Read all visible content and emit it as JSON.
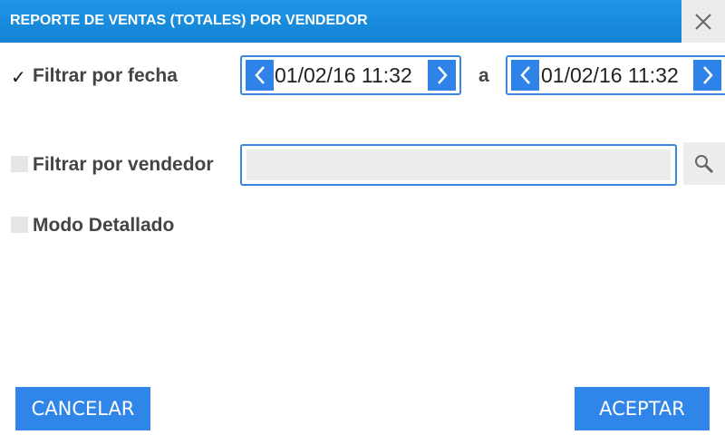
{
  "dialog": {
    "title": "REPORTE DE VENTAS (TOTALES) POR VENDEDOR",
    "close_icon": "close-icon"
  },
  "filters": {
    "date": {
      "check": "✓",
      "label": "Filtrar por fecha",
      "from_value": "01/02/16 11:32",
      "separator": "a",
      "to_value": "01/02/16 11:32"
    },
    "vendor": {
      "label": "Filtrar por vendedor",
      "value": "",
      "search_icon": "search-icon"
    },
    "detailed": {
      "label": "Modo Detallado"
    }
  },
  "buttons": {
    "cancel": "CANCELAR",
    "accept": "ACEPTAR"
  },
  "colors": {
    "accent": "#2f86e8",
    "title_bar": "#1a8bdc"
  }
}
